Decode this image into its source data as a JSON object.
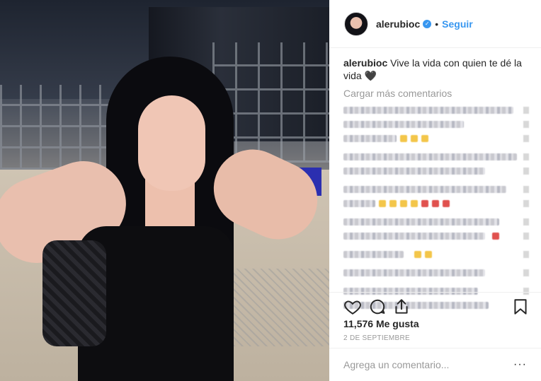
{
  "post": {
    "username": "alerubioc",
    "verified": true,
    "separator": "•",
    "follow_label": "Seguir",
    "caption_username": "alerubioc",
    "caption_text": "Vive la vida con quien te dé la vida 🖤",
    "load_more_label": "Cargar más comentarios",
    "likes": "11,576 Me gusta",
    "date": "2 DE SEPTIEMBRE",
    "comment_placeholder": "Agrega un comentario...",
    "more_options": "···"
  },
  "icons": {
    "like": "heart-icon",
    "comment": "comment-icon",
    "share": "share-icon",
    "save": "bookmark-icon",
    "verified": "verified-badge-icon"
  },
  "colors": {
    "link": "#3897f0",
    "text": "#262626",
    "muted": "#999999",
    "border": "#efefef"
  }
}
